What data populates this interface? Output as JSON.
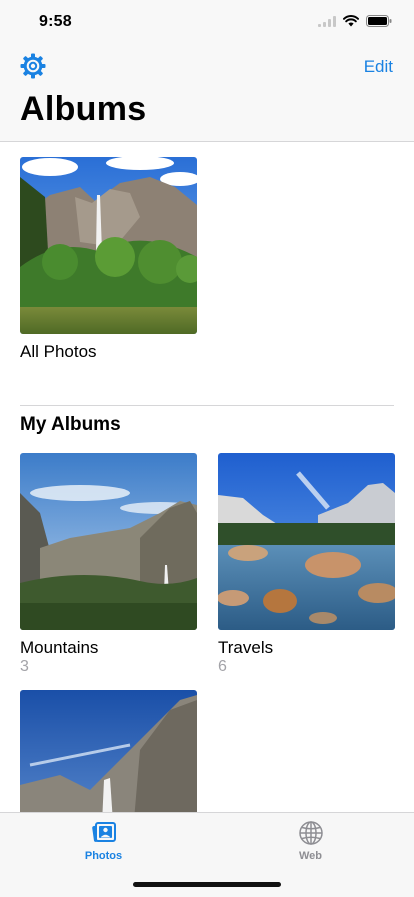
{
  "status_bar": {
    "time": "9:58"
  },
  "nav": {
    "edit_label": "Edit",
    "title": "Albums"
  },
  "all_photos": {
    "title": "All Photos"
  },
  "my_albums": {
    "section_title": "My Albums",
    "albums": [
      {
        "title": "Mountains",
        "count": "3"
      },
      {
        "title": "Travels",
        "count": "6"
      }
    ]
  },
  "tab_bar": {
    "tabs": [
      {
        "label": "Photos",
        "icon": "photos-icon",
        "selected": true
      },
      {
        "label": "Web",
        "icon": "globe-icon",
        "selected": false
      }
    ]
  },
  "colors": {
    "accent": "#1a82e2",
    "inactive": "#8e8e93",
    "secondary_text": "#a3a3a8"
  }
}
